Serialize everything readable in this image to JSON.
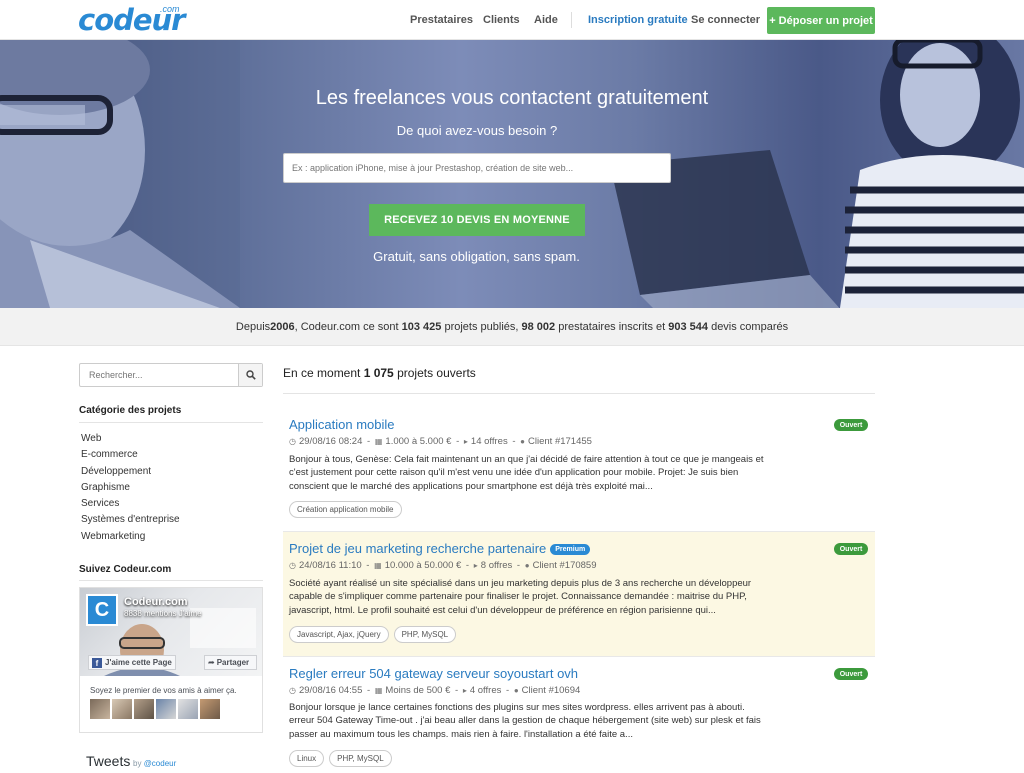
{
  "nav": {
    "logo": "codeur",
    "logo_sup": ".com",
    "prestataires": "Prestataires",
    "clients": "Clients",
    "aide": "Aide",
    "inscription": "Inscription gratuite",
    "connecter": "Se connecter",
    "deposer": "+ Déposer un projet"
  },
  "hero": {
    "title": "Les freelances vous contactent gratuitement",
    "subtitle": "De quoi avez-vous besoin ?",
    "search_placeholder": "Ex : application iPhone, mise à jour Prestashop, création de site web...",
    "cta": "RECEVEZ 10 DEVIS EN MOYENNE",
    "note": "Gratuit, sans obligation, sans spam."
  },
  "stats": {
    "t1": "Depuis ",
    "year": "2006",
    "t2": ", Codeur.com ce sont ",
    "projects": "103 425",
    "t3": " projets publiés, ",
    "providers": "98 002",
    "t4": " prestataires inscrits et ",
    "quotes": "903 544",
    "t5": " devis comparés"
  },
  "sidebar": {
    "search_placeholder": "Rechercher...",
    "categories_title": "Catégorie des projets",
    "categories": [
      "Web",
      "E-commerce",
      "Développement",
      "Graphisme",
      "Services",
      "Systèmes d'entreprise",
      "Webmarketing"
    ],
    "follow_title": "Suivez Codeur.com",
    "fb": {
      "name": "Codeur.com",
      "likes": "8838 mentions J'aime",
      "like_btn": "J'aime cette Page",
      "share_btn": "Partager",
      "friends_text": "Soyez le premier de vos amis à aimer ça."
    },
    "tweets_title": "Tweets",
    "tweets_by": "by",
    "tweets_handle": "@codeur"
  },
  "main": {
    "head_pre": "En ce moment ",
    "open_count": "1 075",
    "head_post": " projets ouverts",
    "projects": [
      {
        "title": "Application mobile",
        "premium": false,
        "premium_label": "",
        "status": "Ouvert",
        "date": "29/08/16 08:24",
        "budget": "1.000 à 5.000 €",
        "offers": "14 offres",
        "client": "Client #171455",
        "desc": "Bonjour à tous, Genèse: Cela fait maintenant un an que j'ai décidé de faire attention à tout ce que je mangeais et c'est justement pour cette raison qu'il m'est venu une idée d'un application pour mobile. Projet: Je suis bien conscient que le marché des applications pour smartphone est déjà très exploité mai...",
        "tags": [
          "Création application mobile"
        ]
      },
      {
        "title": "Projet de jeu marketing recherche partenaire",
        "premium": true,
        "premium_label": "Premium",
        "status": "Ouvert",
        "date": "24/08/16 11:10",
        "budget": "10.000 à 50.000 €",
        "offers": "8 offres",
        "client": "Client #170859",
        "desc": "Société ayant réalisé un site spécialisé dans un jeu marketing depuis plus de 3 ans recherche un développeur capable de s'impliquer comme partenaire pour finaliser le projet. Connaissance demandée : maitrise du PHP, javascript, html. Le profil souhaité est celui d'un développeur de préférence en région parisienne qui...",
        "tags": [
          "Javascript, Ajax, jQuery",
          "PHP, MySQL"
        ]
      },
      {
        "title": "Regler erreur 504 gateway serveur soyoustart ovh",
        "premium": false,
        "premium_label": "",
        "status": "Ouvert",
        "date": "29/08/16 04:55",
        "budget": "Moins de 500 €",
        "offers": "4 offres",
        "client": "Client #10694",
        "desc": "Bonjour lorsque je lance certaines fonctions des plugins sur mes sites wordpress. elles arrivent pas à abouti. erreur 504 Gateway Time-out . j'ai beau aller dans la gestion de chaque hébergement (site web) sur plesk et fais passer au maximum tous les champs. mais rien à faire. l'installation a été faite a...",
        "tags": [
          "Linux",
          "PHP, MySQL"
        ]
      }
    ]
  },
  "colors": {
    "brand_blue": "#2a8ad4",
    "link_blue": "#2a7bc0",
    "green": "#5cb85c",
    "status_green": "#3c9a3c",
    "premium_bg": "#fcf8e3"
  }
}
